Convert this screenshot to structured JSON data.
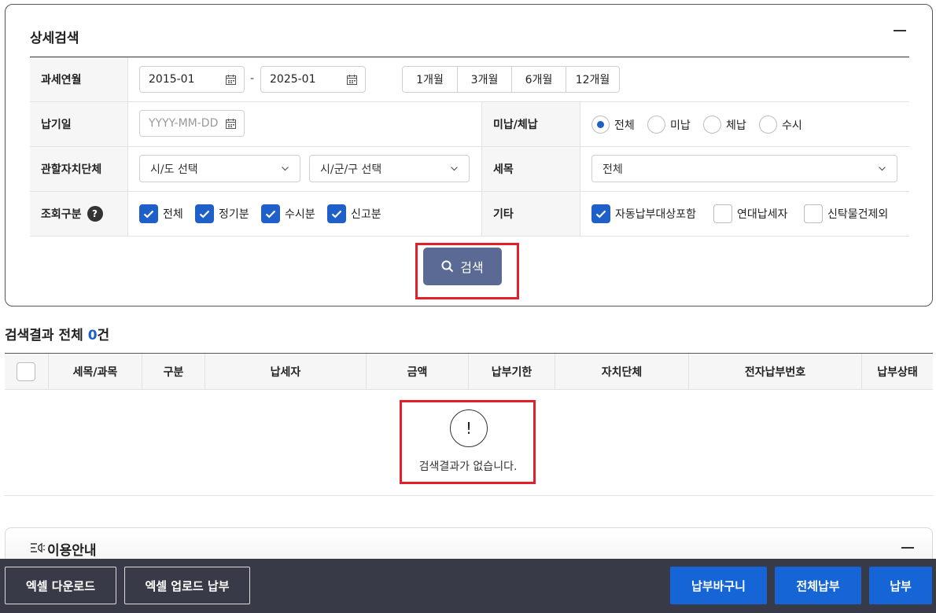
{
  "panel": {
    "title": "상세검색",
    "labels": {
      "tax_month": "과세연월",
      "pay_date": "납기일",
      "unpaid": "미납/체납",
      "local_gov": "관할자치단체",
      "tax_item": "세목",
      "query_type": "조회구분",
      "other": "기타"
    },
    "tax_month_from": "2015-01",
    "tax_month_to": "2025-01",
    "dash": "-",
    "periods": [
      "1개월",
      "3개월",
      "6개월",
      "12개월"
    ],
    "pay_date_placeholder": "YYYY-MM-DD",
    "unpaid_options": [
      "전체",
      "미납",
      "체납",
      "수시"
    ],
    "unpaid_selected": "전체",
    "sido_select": "시/도 선택",
    "sigungu_select": "시/군/구 선택",
    "tax_item_select": "전체",
    "help": "?",
    "query_checks": [
      "전체",
      "정기분",
      "수시분",
      "신고분"
    ],
    "other_checks": [
      "자동납부대상포함",
      "연대납세자",
      "신탁물건제외"
    ],
    "other_checked": [
      true,
      false,
      false
    ],
    "search_button": "검색"
  },
  "results": {
    "title_prefix": "검색결과 전체 ",
    "count": "0",
    "title_suffix": "건",
    "columns": [
      "세목/과목",
      "구분",
      "납세자",
      "금액",
      "납부기한",
      "자치단체",
      "전자납부번호",
      "납부상태"
    ],
    "empty_icon": "!",
    "empty_message": "검색결과가 없습니다."
  },
  "guide": {
    "title": "이용안내"
  },
  "bottom": {
    "excel_download": "엑셀 다운로드",
    "excel_upload_pay": "엑셀 업로드 납부",
    "cart": "납부바구니",
    "pay_all": "전체납부",
    "pay": "납부"
  },
  "colors": {
    "accent": "#1f5fc9",
    "search_button": "#5a6a94",
    "highlight": "#e3202a",
    "bottom_bar": "#383b47",
    "pay_button": "#1565d6"
  }
}
